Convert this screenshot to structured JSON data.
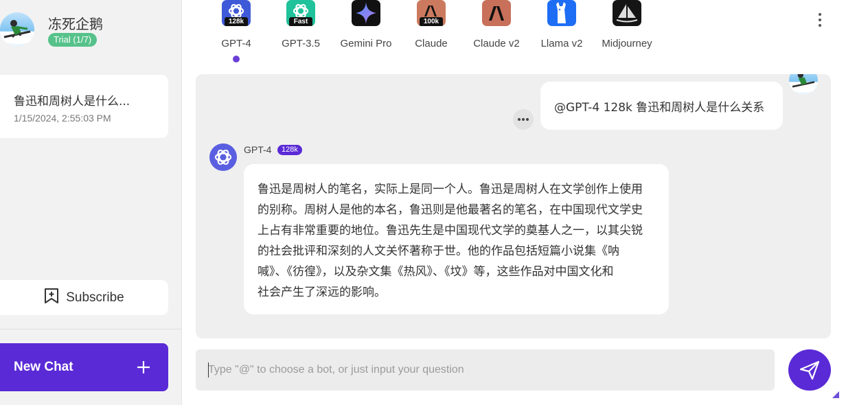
{
  "profile": {
    "username": "冻死企鹅",
    "trial_badge": "Trial (1/7)"
  },
  "history": [
    {
      "title": "鲁迅和周树人是什么...",
      "time": "1/15/2024, 2:55:03 PM"
    }
  ],
  "sidebar": {
    "subscribe_label": "Subscribe",
    "new_chat_label": "New Chat"
  },
  "bots": [
    {
      "name": "GPT-4",
      "badge": "128k",
      "icon": "openai-icon",
      "color": "#3f5ad8",
      "active": true
    },
    {
      "name": "GPT-3.5",
      "badge": "Fast",
      "icon": "openai-icon",
      "color": "#1fc29a",
      "active": false
    },
    {
      "name": "Gemini Pro",
      "badge": "",
      "icon": "gemini-icon",
      "color": "#111111",
      "active": false
    },
    {
      "name": "Claude",
      "badge": "100k",
      "icon": "anthropic-icon",
      "color": "#cc7a5f",
      "active": false
    },
    {
      "name": "Claude v2",
      "badge": "",
      "icon": "anthropic-icon",
      "color": "#c9705a",
      "active": false
    },
    {
      "name": "Llama v2",
      "badge": "",
      "icon": "llama-icon",
      "color": "#1e6ef5",
      "active": false
    },
    {
      "name": "Midjourney",
      "badge": "",
      "icon": "midjourney-icon",
      "color": "#151515",
      "active": false
    }
  ],
  "chat": {
    "user_message": "@GPT-4 128k 鲁迅和周树人是什么关系",
    "bot_name": "GPT-4",
    "bot_model_badge": "128k",
    "bot_response_lines": [
      "鲁迅是周树人的笔名，实际上是同一个人。鲁迅是周树人在文学创作上使用",
      "的别称。周树人是他的本名，鲁迅则是他最著名的笔名，在中国现代文学史",
      "上占有非常重要的地位。鲁迅先生是中国现代文学的奠基人之一，以其尖锐",
      "的社会批评和深刻的人文关怀著称于世。他的作品包括短篇小说集《呐",
      "喊》、《彷徨》，以及杂文集《热风》、《坟》等，这些作品对中国文化和",
      "社会产生了深远的影响。"
    ]
  },
  "input": {
    "placeholder": "Type \"@\" to choose a bot, or just input your question",
    "value": ""
  },
  "colors": {
    "accent": "#5a2ad6",
    "trial_green": "#56c28a"
  }
}
